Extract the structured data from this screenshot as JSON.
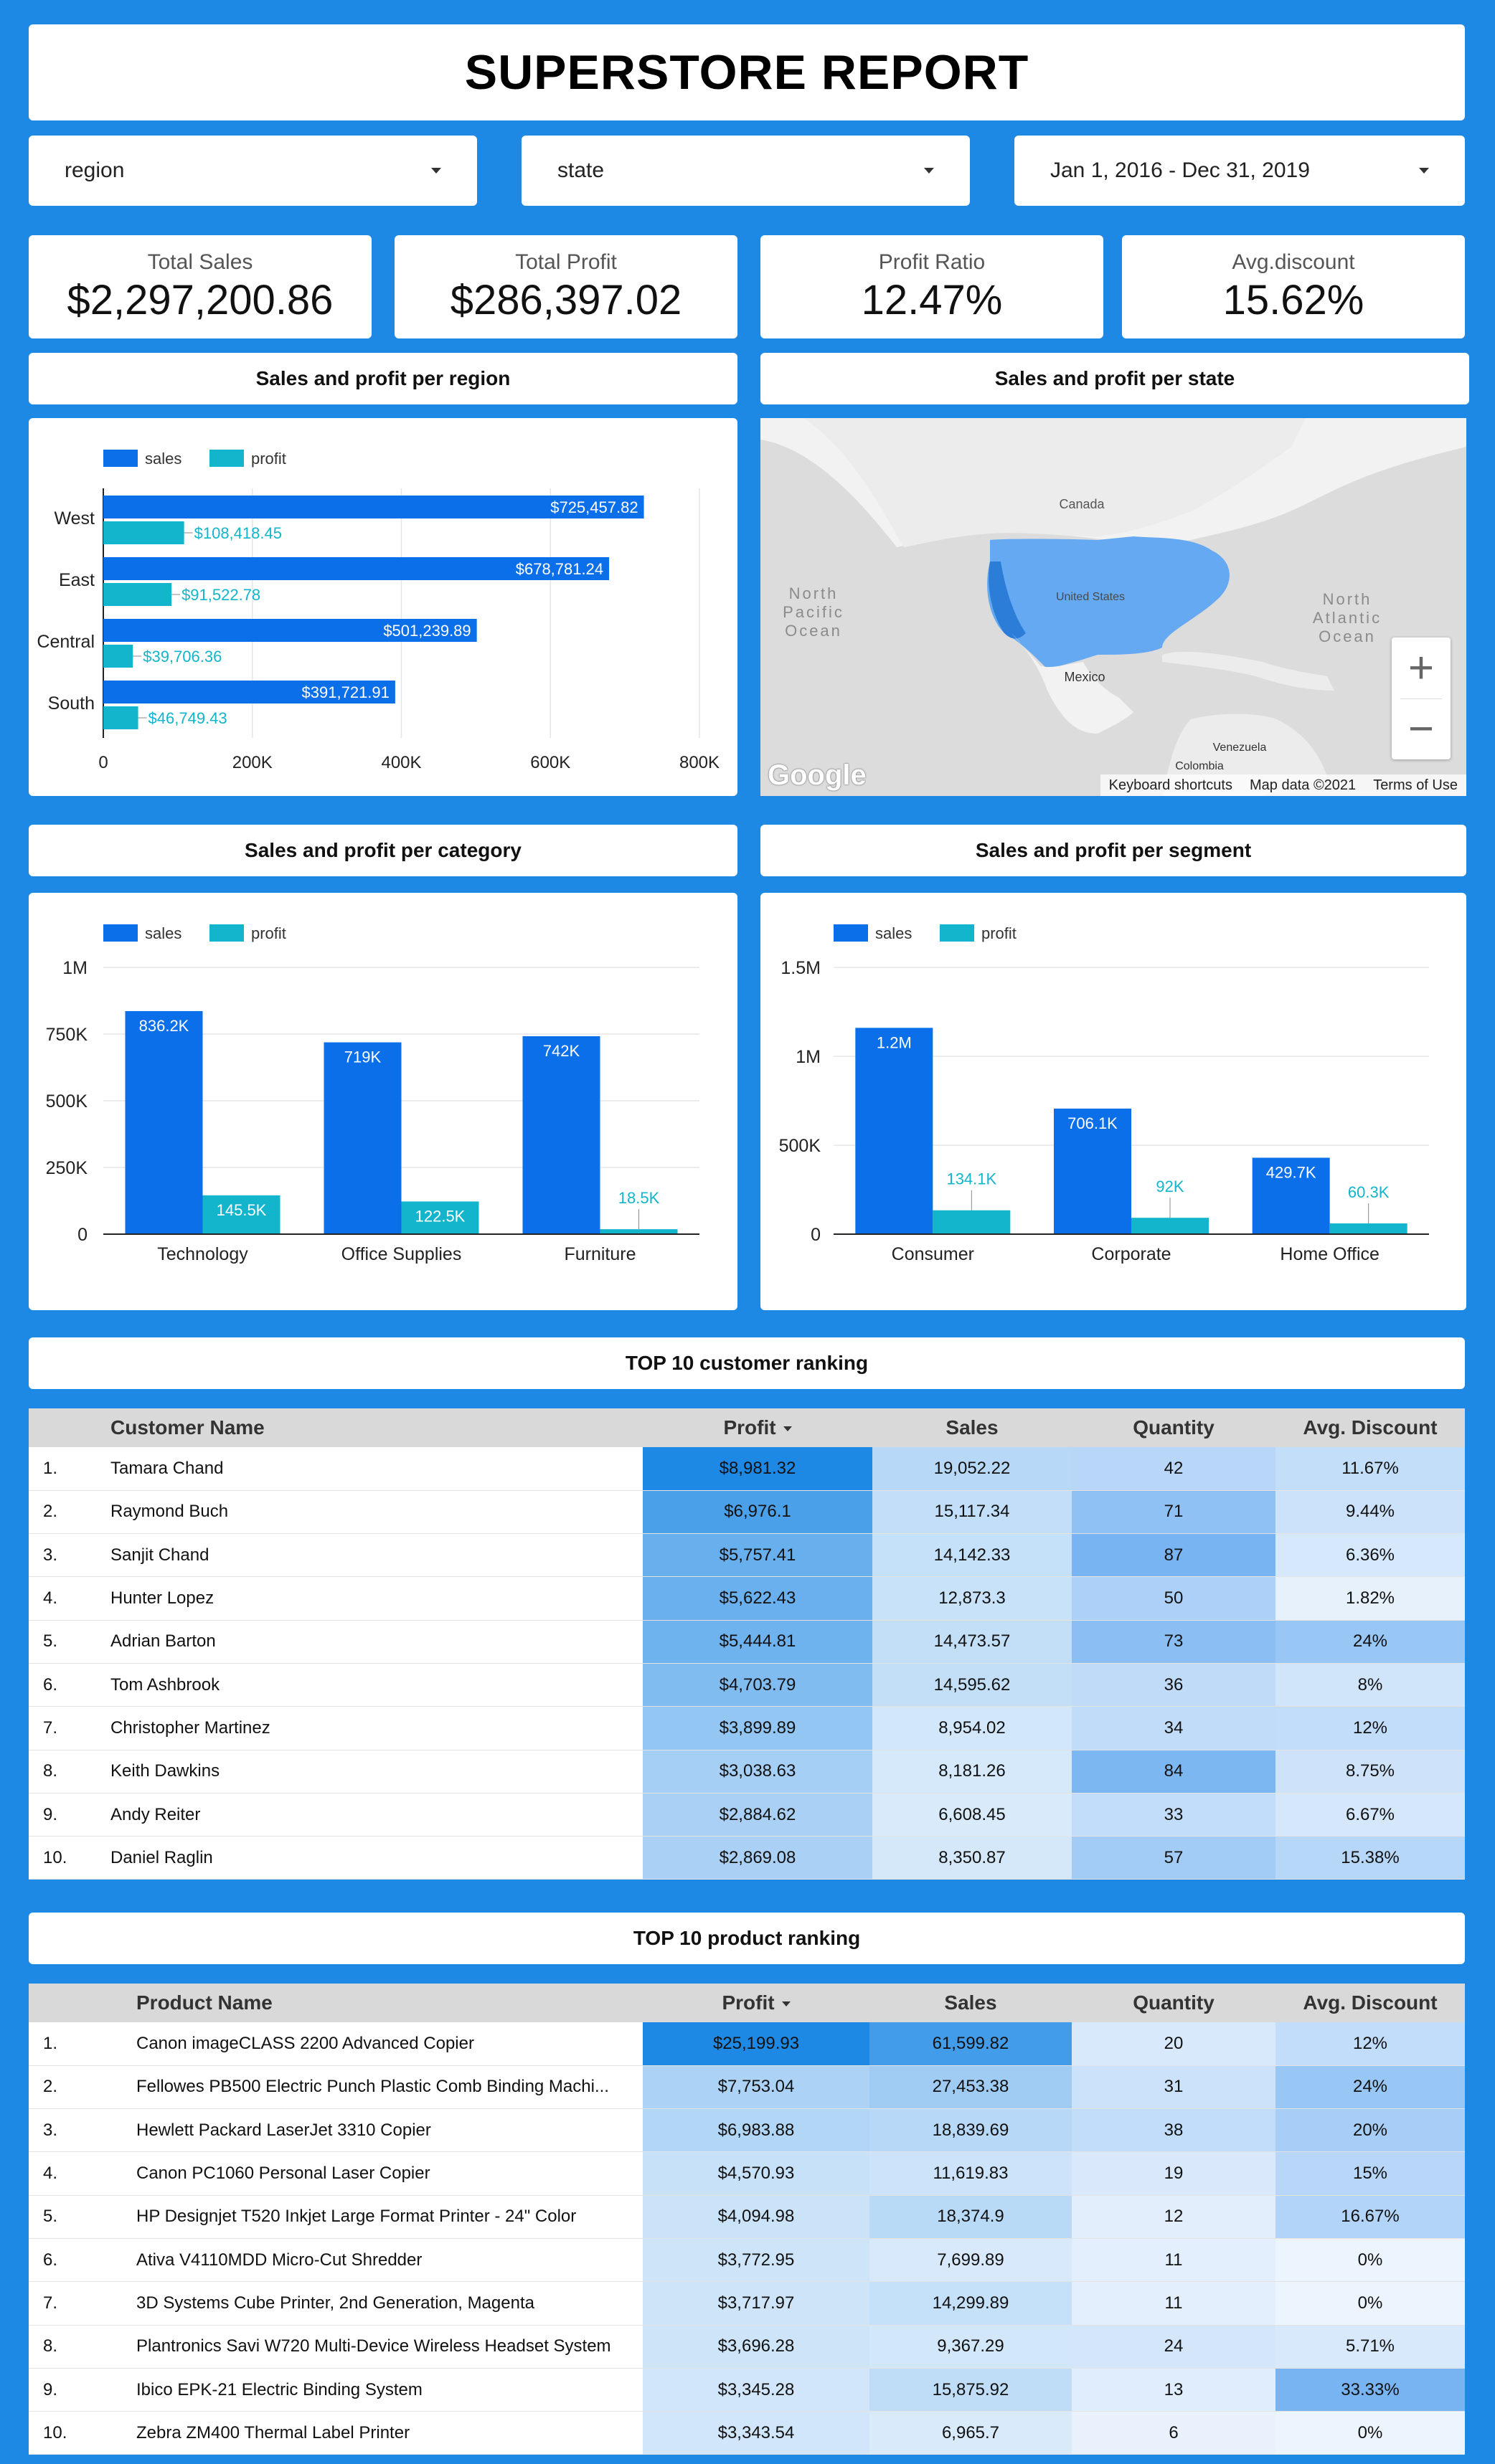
{
  "header": {
    "title": "SUPERSTORE REPORT"
  },
  "filters": {
    "region": "region",
    "state": "state",
    "date_range": "Jan 1, 2016 - Dec 31, 2019"
  },
  "kpis": [
    {
      "label": "Total Sales",
      "value": "$2,297,200.86"
    },
    {
      "label": "Total Profit",
      "value": "$286,397.02"
    },
    {
      "label": "Profit Ratio",
      "value": "12.47%"
    },
    {
      "label": "Avg.discount",
      "value": "15.62%"
    }
  ],
  "sections": {
    "region": "Sales and profit per region",
    "state": "Sales and profit per state",
    "category": "Sales and profit per category",
    "segment": "Sales and profit per segment",
    "customers": "TOP 10 customer ranking",
    "products": "TOP 10 product ranking"
  },
  "colors": {
    "background": "#1e88e5",
    "sales": "#0a6fe8",
    "profit": "#12b5cb"
  },
  "map": {
    "labels": [
      "Canada",
      "United States",
      "Mexico",
      "Venezuela",
      "Colombia"
    ],
    "ocean_labels": [
      [
        "North",
        "Pacific",
        "Ocean"
      ],
      [
        "North",
        "Atlantic",
        "Ocean"
      ]
    ],
    "zoom_in": "+",
    "zoom_out": "−",
    "logo": "Google",
    "footer": [
      "Keyboard shortcuts",
      "Map data ©2021",
      "Terms of Use"
    ]
  },
  "chart_data": [
    {
      "type": "bar",
      "orientation": "horizontal",
      "categories": [
        "West",
        "East",
        "Central",
        "South"
      ],
      "series": [
        {
          "name": "sales",
          "values": [
            725457.82,
            678781.24,
            501239.89,
            391721.91
          ],
          "labels": [
            "$725,457.82",
            "$678,781.24",
            "$501,239.89",
            "$391,721.91"
          ]
        },
        {
          "name": "profit",
          "values": [
            108418.45,
            91522.78,
            39706.36,
            46749.43
          ],
          "labels": [
            "$108,418.45",
            "$91,522.78",
            "$39,706.36",
            "$46,749.43"
          ]
        }
      ],
      "xlim": [
        0,
        800000
      ],
      "ticks": [
        0,
        200000,
        400000,
        600000,
        800000
      ],
      "tick_labels": [
        "0",
        "200K",
        "400K",
        "600K",
        "800K"
      ],
      "grid": true,
      "legend": "top-left"
    },
    {
      "type": "bar",
      "categories": [
        "Technology",
        "Office Supplies",
        "Furniture"
      ],
      "series": [
        {
          "name": "sales",
          "values": [
            836200,
            719000,
            742000
          ],
          "labels": [
            "836.2K",
            "719K",
            "742K"
          ]
        },
        {
          "name": "profit",
          "values": [
            145500,
            122500,
            18500
          ],
          "labels": [
            "145.5K",
            "122.5K",
            "18.5K"
          ]
        }
      ],
      "ylim": [
        0,
        1000000
      ],
      "ticks": [
        0,
        250000,
        500000,
        750000,
        1000000
      ],
      "tick_labels": [
        "0",
        "250K",
        "500K",
        "750K",
        "1M"
      ],
      "grid": true,
      "legend": "top-left"
    },
    {
      "type": "bar",
      "categories": [
        "Consumer",
        "Corporate",
        "Home Office"
      ],
      "series": [
        {
          "name": "sales",
          "values": [
            1160000,
            706100,
            429700
          ],
          "labels": [
            "1.2M",
            "706.1K",
            "429.7K"
          ]
        },
        {
          "name": "profit",
          "values": [
            134100,
            92000,
            60300
          ],
          "labels": [
            "134.1K",
            "92K",
            "60.3K"
          ]
        }
      ],
      "ylim": [
        0,
        1500000
      ],
      "ticks": [
        0,
        500000,
        1000000,
        1500000
      ],
      "tick_labels": [
        "0",
        "500K",
        "1M",
        "1.5M"
      ],
      "grid": true,
      "legend": "top-left"
    }
  ],
  "customers": {
    "headers": [
      "Customer Name",
      "Profit",
      "Sales",
      "Quantity",
      "Avg. Discount"
    ],
    "rows": [
      {
        "idx": "1.",
        "name": "Tamara Chand",
        "profit": "$8,981.32",
        "sales": "19,052.22",
        "quantity": "42",
        "discount": "11.67%",
        "shade": [
          1.0,
          0.31,
          0.47,
          0.35
        ]
      },
      {
        "idx": "2.",
        "name": "Raymond Buch",
        "profit": "$6,976.1",
        "sales": "15,117.34",
        "quantity": "71",
        "discount": "9.44%",
        "shade": [
          0.78,
          0.25,
          0.8,
          0.28
        ]
      },
      {
        "idx": "3.",
        "name": "Sanjit Chand",
        "profit": "$5,757.41",
        "sales": "14,142.33",
        "quantity": "87",
        "discount": "6.36%",
        "shade": [
          0.64,
          0.23,
          1.0,
          0.19
        ]
      },
      {
        "idx": "4.",
        "name": "Hunter Lopez",
        "profit": "$5,622.43",
        "sales": "12,873.3",
        "quantity": "50",
        "discount": "1.82%",
        "shade": [
          0.63,
          0.21,
          0.57,
          0.05
        ]
      },
      {
        "idx": "5.",
        "name": "Adrian Barton",
        "profit": "$5,444.81",
        "sales": "14,473.57",
        "quantity": "73",
        "discount": "24%",
        "shade": [
          0.61,
          0.24,
          0.84,
          0.72
        ]
      },
      {
        "idx": "6.",
        "name": "Tom Ashbrook",
        "profit": "$4,703.79",
        "sales": "14,595.62",
        "quantity": "36",
        "discount": "8%",
        "shade": [
          0.52,
          0.24,
          0.41,
          0.24
        ]
      },
      {
        "idx": "7.",
        "name": "Christopher Martinez",
        "profit": "$3,899.89",
        "sales": "8,954.02",
        "quantity": "34",
        "discount": "12%",
        "shade": [
          0.43,
          0.15,
          0.39,
          0.36
        ]
      },
      {
        "idx": "8.",
        "name": "Keith Dawkins",
        "profit": "$3,038.63",
        "sales": "8,181.26",
        "quantity": "84",
        "discount": "8.75%",
        "shade": [
          0.34,
          0.13,
          0.96,
          0.26
        ]
      },
      {
        "idx": "9.",
        "name": "Andy Reiter",
        "profit": "$2,884.62",
        "sales": "6,608.45",
        "quantity": "33",
        "discount": "6.67%",
        "shade": [
          0.32,
          0.11,
          0.38,
          0.2
        ]
      },
      {
        "idx": "10.",
        "name": "Daniel Raglin",
        "profit": "$2,869.08",
        "sales": "8,350.87",
        "quantity": "57",
        "discount": "15.38%",
        "shade": [
          0.32,
          0.14,
          0.65,
          0.46
        ]
      }
    ]
  },
  "products": {
    "headers": [
      "Product Name",
      "Profit",
      "Sales",
      "Quantity",
      "Avg. Discount"
    ],
    "rows": [
      {
        "idx": "1.",
        "name": "Canon imageCLASS 2200 Advanced Copier",
        "profit": "$25,199.93",
        "sales": "61,599.82",
        "quantity": "20",
        "discount": "12%",
        "shade": [
          1.0,
          1.0,
          0.2,
          0.36
        ]
      },
      {
        "idx": "2.",
        "name": "Fellowes PB500 Electric Punch Plastic Comb Binding Machi...",
        "profit": "$7,753.04",
        "sales": "27,453.38",
        "quantity": "31",
        "discount": "24%",
        "shade": [
          0.31,
          0.45,
          0.31,
          0.72
        ]
      },
      {
        "idx": "3.",
        "name": "Hewlett Packard LaserJet 3310 Copier",
        "profit": "$6,983.88",
        "sales": "18,839.69",
        "quantity": "38",
        "discount": "20%",
        "shade": [
          0.28,
          0.31,
          0.38,
          0.6
        ]
      },
      {
        "idx": "4.",
        "name": "Canon PC1060 Personal Laser Copier",
        "profit": "$4,570.93",
        "sales": "11,619.83",
        "quantity": "19",
        "discount": "15%",
        "shade": [
          0.18,
          0.19,
          0.19,
          0.45
        ]
      },
      {
        "idx": "5.",
        "name": "HP Designjet T520 Inkjet Large Format Printer - 24\" Color",
        "profit": "$4,094.98",
        "sales": "18,374.9",
        "quantity": "12",
        "discount": "16.67%",
        "shade": [
          0.16,
          0.3,
          0.12,
          0.5
        ]
      },
      {
        "idx": "6.",
        "name": "Ativa V4110MDD Micro-Cut Shredder",
        "profit": "$3,772.95",
        "sales": "7,699.89",
        "quantity": "11",
        "discount": "0%",
        "shade": [
          0.15,
          0.12,
          0.11,
          0.0
        ]
      },
      {
        "idx": "7.",
        "name": "3D Systems Cube Printer, 2nd Generation, Magenta",
        "profit": "$3,717.97",
        "sales": "14,299.89",
        "quantity": "11",
        "discount": "0%",
        "shade": [
          0.15,
          0.23,
          0.11,
          0.0
        ]
      },
      {
        "idx": "8.",
        "name": "Plantronics Savi W720 Multi-Device Wireless Headset System",
        "profit": "$3,696.28",
        "sales": "9,367.29",
        "quantity": "24",
        "discount": "5.71%",
        "shade": [
          0.15,
          0.15,
          0.24,
          0.17
        ]
      },
      {
        "idx": "9.",
        "name": "Ibico EPK-21 Electric Binding System",
        "profit": "$3,345.28",
        "sales": "15,875.92",
        "quantity": "13",
        "discount": "33.33%",
        "shade": [
          0.13,
          0.26,
          0.13,
          1.0
        ]
      },
      {
        "idx": "10.",
        "name": "Zebra ZM400 Thermal Label Printer",
        "profit": "$3,343.54",
        "sales": "6,965.7",
        "quantity": "6",
        "discount": "0%",
        "shade": [
          0.13,
          0.11,
          0.06,
          0.0
        ]
      }
    ]
  }
}
